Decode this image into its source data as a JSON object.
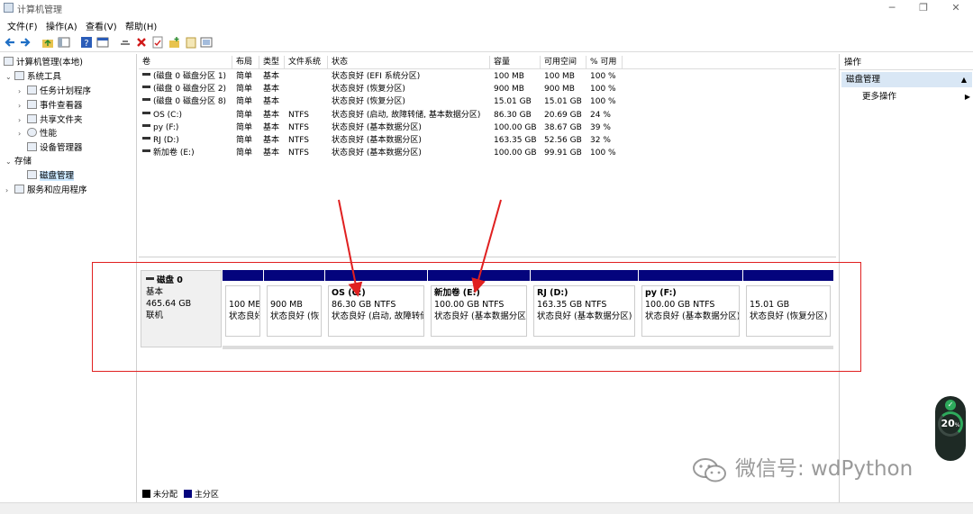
{
  "window": {
    "title": "计算机管理",
    "minimize": "─",
    "maximize": "❐",
    "close": "✕"
  },
  "menu": [
    "文件(F)",
    "操作(A)",
    "查看(V)",
    "帮助(H)"
  ],
  "tree": {
    "root": "计算机管理(本地)",
    "system_tools": "系统工具",
    "task_scheduler": "任务计划程序",
    "event_viewer": "事件查看器",
    "shared_folders": "共享文件夹",
    "performance": "性能",
    "device_manager": "设备管理器",
    "storage": "存储",
    "disk_management": "磁盘管理",
    "services_apps": "服务和应用程序"
  },
  "volume_table": {
    "headers": [
      "卷",
      "布局",
      "类型",
      "文件系统",
      "状态",
      "容量",
      "可用空间",
      "% 可用"
    ],
    "rows": [
      [
        "(磁盘 0 磁盘分区 1)",
        "简单",
        "基本",
        "",
        "状态良好 (EFI 系统分区)",
        "100 MB",
        "100 MB",
        "100 %"
      ],
      [
        "(磁盘 0 磁盘分区 2)",
        "简单",
        "基本",
        "",
        "状态良好 (恢复分区)",
        "900 MB",
        "900 MB",
        "100 %"
      ],
      [
        "(磁盘 0 磁盘分区 8)",
        "简单",
        "基本",
        "",
        "状态良好 (恢复分区)",
        "15.01 GB",
        "15.01 GB",
        "100 %"
      ],
      [
        "OS (C:)",
        "简单",
        "基本",
        "NTFS",
        "状态良好 (启动, 故障转储, 基本数据分区)",
        "86.30 GB",
        "20.69 GB",
        "24 %"
      ],
      [
        "py (F:)",
        "简单",
        "基本",
        "NTFS",
        "状态良好 (基本数据分区)",
        "100.00 GB",
        "38.67 GB",
        "39 %"
      ],
      [
        "RJ (D:)",
        "简单",
        "基本",
        "NTFS",
        "状态良好 (基本数据分区)",
        "163.35 GB",
        "52.56 GB",
        "32 %"
      ],
      [
        "新加卷 (E:)",
        "简单",
        "基本",
        "NTFS",
        "状态良好 (基本数据分区)",
        "100.00 GB",
        "99.91 GB",
        "100 %"
      ]
    ]
  },
  "disk": {
    "name": "磁盘 0",
    "type": "基本",
    "size": "465.64 GB",
    "status": "联机",
    "partitions": [
      {
        "name": "",
        "size": "100 ME",
        "status": "状态良好"
      },
      {
        "name": "",
        "size": "900 MB",
        "status": "状态良好 (恢"
      },
      {
        "name": "OS  (C:)",
        "size": "86.30 GB NTFS",
        "status": "状态良好 (启动, 故障转储"
      },
      {
        "name": "新加卷  (E:)",
        "size": "100.00 GB NTFS",
        "status": "状态良好 (基本数据分区)"
      },
      {
        "name": "RJ  (D:)",
        "size": "163.35 GB NTFS",
        "status": "状态良好 (基本数据分区)"
      },
      {
        "name": "py  (F:)",
        "size": "100.00 GB NTFS",
        "status": "状态良好 (基本数据分区)"
      },
      {
        "name": "",
        "size": "15.01 GB",
        "status": "状态良好 (恢复分区)"
      }
    ]
  },
  "legend": {
    "unallocated": "未分配",
    "primary": "主分区",
    "unallocated_color": "#000000",
    "primary_color": "#04047d"
  },
  "actions": {
    "title": "操作",
    "selected": "磁盘管理",
    "more": "更多操作"
  },
  "meter": {
    "value": "20",
    "unit": "%"
  },
  "watermark": "微信号: wdPython",
  "colors": {
    "partition_bar": "#04047d",
    "highlight": "#e02020",
    "selection": "#cce8ff"
  }
}
